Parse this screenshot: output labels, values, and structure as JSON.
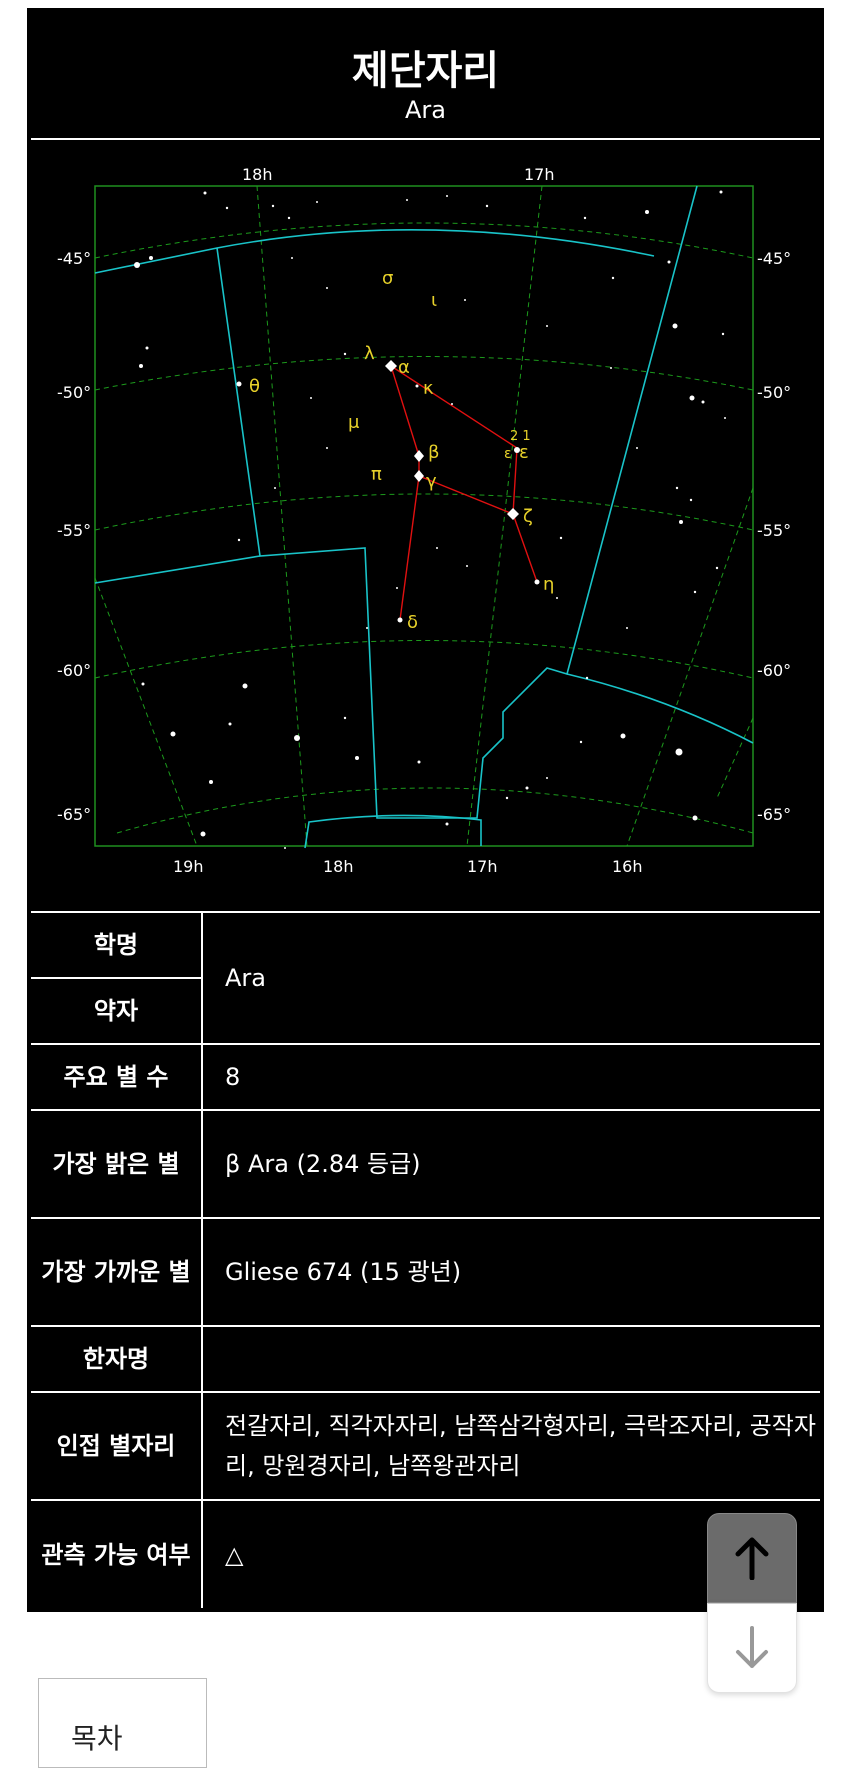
{
  "infobox": {
    "title": "제단자리",
    "subtitle": "Ara",
    "rows": [
      {
        "label": "학명",
        "value": "Ara"
      },
      {
        "label": "약자",
        "value": ""
      },
      {
        "label": "주요 별 수",
        "value": "8"
      },
      {
        "label": "가장 밝은 별",
        "value": "β Ara (2.84 등급)"
      },
      {
        "label": "가장 가까운 별",
        "value": "Gliese 674 (15 광년)"
      },
      {
        "label": "한자명",
        "value": ""
      },
      {
        "label": "인접 별자리",
        "value": "전갈자리, 직각자자리, 남쪽삼각형자리, 극락조자리, 공작자리, 망원경자리, 남쪽왕관자리"
      },
      {
        "label": "관측 가능 여부",
        "value": "△"
      }
    ]
  },
  "star_map": {
    "top_ra_labels": [
      "18h",
      "17h"
    ],
    "bottom_ra_labels": [
      "19h",
      "18h",
      "17h",
      "16h"
    ],
    "dec_labels": [
      "-45°",
      "-50°",
      "-55°",
      "-60°",
      "-65°"
    ],
    "star_labels": [
      "σ",
      "ι",
      "λ",
      "α",
      "κ",
      "θ",
      "μ",
      "ε¹",
      "ε²",
      "π",
      "β",
      "γ",
      "ζ",
      "η",
      "δ"
    ],
    "colors": {
      "background": "#000000",
      "frame": "#1f8f1f",
      "boundary": "#19c3c8",
      "lines": "#e01010",
      "labels": "#e7d12a",
      "grid": "#1c9a1c"
    }
  },
  "buttons": {
    "scroll_up": "arrow-up-icon",
    "scroll_down": "arrow-down-icon"
  },
  "toc": {
    "label": "목차"
  }
}
